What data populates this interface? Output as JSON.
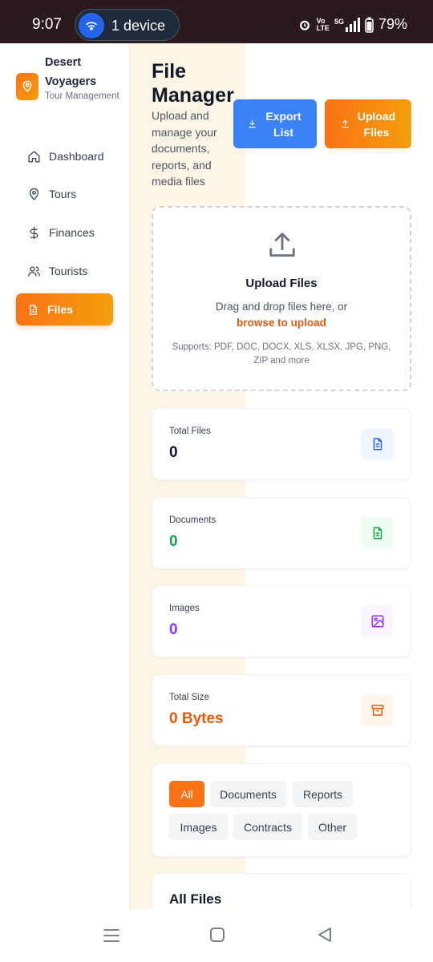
{
  "status_bar": {
    "time": "9:07",
    "device_label": "1 device",
    "network_top": "Vo",
    "network_bottom": "LTE",
    "signal_label": "5G",
    "battery": "79%"
  },
  "sidebar": {
    "brand_name": "Desert Voyagers",
    "brand_subtitle": "Tour Management",
    "items": [
      {
        "label": "Dashboard",
        "icon": "home-icon",
        "active": false
      },
      {
        "label": "Tours",
        "icon": "map-pin-icon",
        "active": false
      },
      {
        "label": "Finances",
        "icon": "dollar-icon",
        "active": false
      },
      {
        "label": "Tourists",
        "icon": "users-icon",
        "active": false
      },
      {
        "label": "Files",
        "icon": "file-icon",
        "active": true
      }
    ]
  },
  "header": {
    "title": "File Manager",
    "description": "Upload and manage your documents, reports, and media files",
    "export_label": "Export List",
    "upload_label": "Upload Files"
  },
  "dropzone": {
    "title": "Upload Files",
    "text": "Drag and drop files here, or",
    "link": "browse to upload",
    "supports": "Supports: PDF, DOC, DOCX, XLS, XLSX, JPG, PNG, ZIP and more"
  },
  "stats": [
    {
      "label": "Total Files",
      "value": "0",
      "color": "#111827",
      "icon": "document-icon",
      "icon_bg": "#eff6ff",
      "icon_color": "#2563eb"
    },
    {
      "label": "Documents",
      "value": "0",
      "color": "#16a34a",
      "icon": "document-icon",
      "icon_bg": "#f0fdf4",
      "icon_color": "#16a34a"
    },
    {
      "label": "Images",
      "value": "0",
      "color": "#9333ea",
      "icon": "image-icon",
      "icon_bg": "#faf5ff",
      "icon_color": "#9333ea"
    },
    {
      "label": "Total Size",
      "value": "0 Bytes",
      "color": "#ea580c",
      "icon": "archive-icon",
      "icon_bg": "#fff7ed",
      "icon_color": "#ea580c"
    }
  ],
  "filters": {
    "options": [
      "All",
      "Documents",
      "Reports",
      "Images",
      "Contracts",
      "Other"
    ],
    "selected": "All"
  },
  "files_section": {
    "title": "All Files"
  },
  "colors": {
    "accent_orange": "#f97316",
    "accent_blue": "#3b82f6"
  }
}
